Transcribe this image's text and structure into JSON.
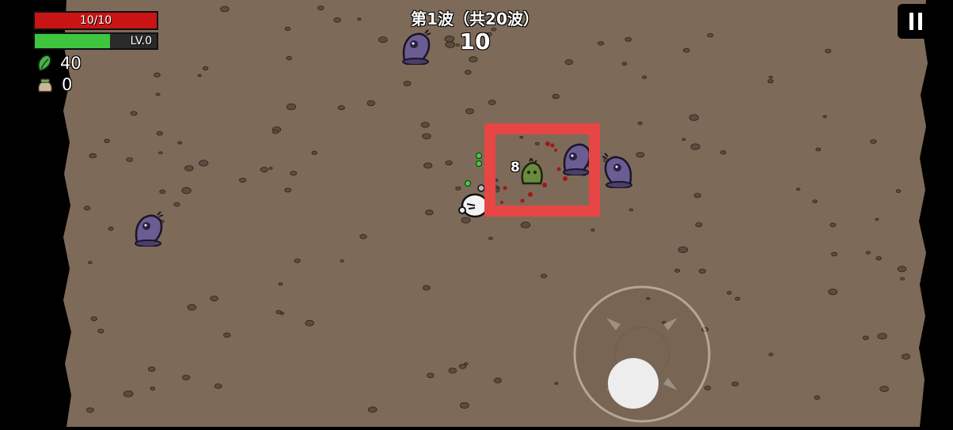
{
  "hud": {
    "hp": {
      "label": "10/10",
      "fraction": 1.0,
      "color": "#c81414"
    },
    "xp": {
      "label": "LV.0",
      "fraction": 0.62,
      "color": "#3ec43e"
    },
    "materials": {
      "icon": "material-leaf-icon",
      "value": "40"
    },
    "bag": {
      "icon": "loot-bag-icon",
      "value": "0"
    }
  },
  "wave": {
    "title": "第1波（共20波）",
    "timer": "10"
  },
  "combat": {
    "damage_number": "8"
  },
  "colors": {
    "ground": "#7e6a58",
    "enemy": "#6b5d94",
    "highlight": "#e84545"
  }
}
